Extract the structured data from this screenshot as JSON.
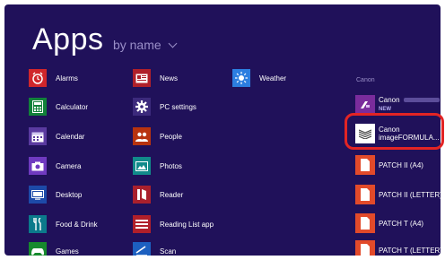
{
  "header": {
    "title": "Apps",
    "sort_label": "by name"
  },
  "columns": [
    [
      {
        "label": "Alarms",
        "icon": "alarm-clock-icon",
        "color": "#d0262b"
      },
      {
        "label": "Calculator",
        "icon": "calculator-icon",
        "color": "#12813a"
      },
      {
        "label": "Calendar",
        "icon": "calendar-icon",
        "color": "#5a3aa0"
      },
      {
        "label": "Camera",
        "icon": "camera-icon",
        "color": "#6f3ac0"
      },
      {
        "label": "Desktop",
        "icon": "desktop-icon",
        "color": "#1d4aa8"
      },
      {
        "label": "Food & Drink",
        "icon": "food-drink-icon",
        "color": "#0b7a8b"
      },
      {
        "label": "Games",
        "icon": "game-controller-icon",
        "color": "#178a2d"
      }
    ],
    [
      {
        "label": "News",
        "icon": "news-icon",
        "color": "#b0202a"
      },
      {
        "label": "PC settings",
        "icon": "gear-icon",
        "color": "#3c2a7c"
      },
      {
        "label": "People",
        "icon": "people-icon",
        "color": "#b8330f"
      },
      {
        "label": "Photos",
        "icon": "photos-icon",
        "color": "#118a8a"
      },
      {
        "label": "Reader",
        "icon": "reader-icon",
        "color": "#a9202d"
      },
      {
        "label": "Reading List app",
        "icon": "reading-list-icon",
        "color": "#b01f2a"
      },
      {
        "label": "Scan",
        "icon": "scan-icon",
        "color": "#1c60c0"
      }
    ],
    [
      {
        "label": "Weather",
        "icon": "weather-sun-icon",
        "color": "#2c7ee0"
      }
    ]
  ],
  "group": {
    "title": "Canon",
    "apps": [
      {
        "line1": "Canon",
        "line2": "NEW",
        "icon": "canon-app-icon",
        "color": "#7a2c9c"
      },
      {
        "line1": "Canon",
        "line2": "imageFORMULA...",
        "icon": "document-stack-icon",
        "color": "#ffffff"
      },
      {
        "line1": "PATCH II (A4)",
        "icon": "pdf-document-icon",
        "color": "#e24a2a"
      },
      {
        "line1": "PATCH II (LETTER)",
        "icon": "pdf-document-icon",
        "color": "#e24a2a"
      },
      {
        "line1": "PATCH T (A4)",
        "icon": "pdf-document-icon",
        "color": "#e24a2a"
      },
      {
        "line1": "PATCH T (LETTER)",
        "icon": "pdf-document-icon",
        "color": "#e24a2a"
      }
    ]
  },
  "highlight_color": "#e32424"
}
